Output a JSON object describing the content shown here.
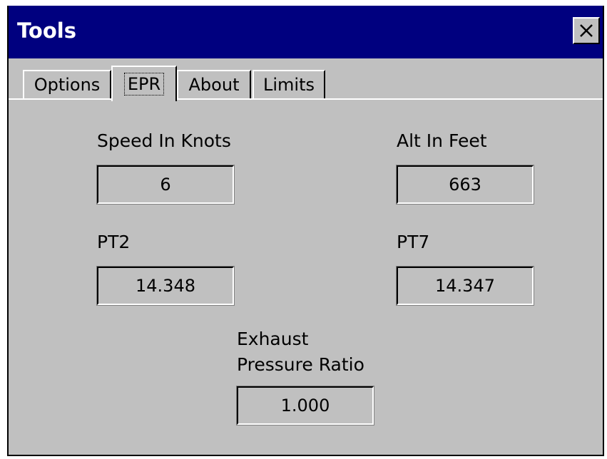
{
  "window": {
    "title": "Tools",
    "close_glyph": "✕"
  },
  "tabs": [
    {
      "label": "Options",
      "active": false
    },
    {
      "label": "EPR",
      "active": true
    },
    {
      "label": "About",
      "active": false
    },
    {
      "label": "Limits",
      "active": false
    }
  ],
  "epr": {
    "speed_label": "Speed In Knots",
    "speed_value": "6",
    "alt_label": "Alt In Feet",
    "alt_value": "663",
    "pt2_label": "PT2",
    "pt2_value": "14.348",
    "pt7_label": "PT7",
    "pt7_value": "14.347",
    "epr_label_line1": "Exhaust",
    "epr_label_line2": "Pressure Ratio",
    "epr_value": "1.000"
  }
}
